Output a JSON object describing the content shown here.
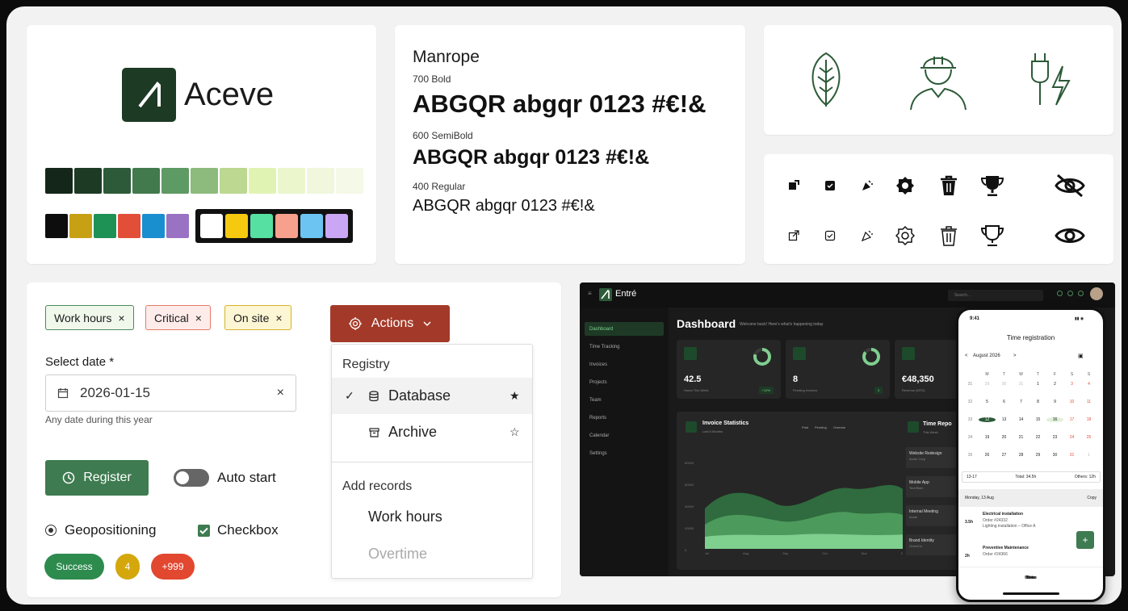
{
  "brand": {
    "name": "Aceve"
  },
  "palette": {
    "greens": [
      "#14261a",
      "#1d3a24",
      "#2d5a38",
      "#427a4e",
      "#5e9a63",
      "#8dba7d",
      "#bcd891",
      "#e1f3b2",
      "#ebf6cd",
      "#f0f7dc",
      "#f4f9e8"
    ],
    "accents": [
      "#0d0d0d",
      "#c8a013",
      "#1e9155",
      "#e24e38",
      "#1a8fd0",
      "#9a72c3"
    ],
    "accents_light": [
      "#ffffff",
      "#f5c90f",
      "#56e0a2",
      "#f7a08e",
      "#6cc4f2",
      "#cba6f5"
    ]
  },
  "typography": {
    "family": "Manrope",
    "styles": [
      {
        "weight_label": "700 Bold",
        "sample": "ABGQR abgqr 0123 #€!&"
      },
      {
        "weight_label": "600 SemiBold",
        "sample": "ABGQR abgqr 0123 #€!&"
      },
      {
        "weight_label": "400 Regular",
        "sample": "ABGQR abgqr 0123 #€!&"
      }
    ]
  },
  "form": {
    "chips": [
      {
        "label": "Work hours",
        "close": "×"
      },
      {
        "label": "Critical",
        "close": "×"
      },
      {
        "label": "On site",
        "close": "×"
      }
    ],
    "date_label": "Select date *",
    "date_value": "2026-01-15",
    "date_clear": "×",
    "date_hint": "Any date during this year",
    "register_label": "Register",
    "toggle_label": "Auto start",
    "radio_label": "Geopositioning",
    "checkbox_label": "Checkbox",
    "badges": [
      "Success",
      "4",
      "+999"
    ],
    "actions_label": "Actions",
    "menu": {
      "section1": "Registry",
      "item_database": "Database",
      "item_archive": "Archive",
      "section2": "Add records",
      "item_work_hours": "Work hours",
      "item_overtime": "Overtime"
    }
  },
  "dashboard": {
    "app_name": "Entré",
    "search_placeholder": "Search...",
    "title": "Dashboard",
    "welcome": "Welcome back! Here's what's happening today",
    "nav": [
      "Dashboard",
      "Time Tracking",
      "Invoices",
      "Projects",
      "Team",
      "Reports",
      "Calendar",
      "Settings"
    ],
    "kpis": [
      {
        "value": "42.5",
        "label": "Hours This Week",
        "tag": "+12%"
      },
      {
        "value": "8",
        "label": "Pending invoices",
        "tag": "3"
      },
      {
        "value": "€48,350",
        "label": "Revenue (MTD)",
        "tag": ""
      }
    ],
    "chart_title": "Invoice Statistics",
    "chart_sub": "Last 6 Months",
    "legend": [
      "Paid",
      "Pending",
      "Overdue"
    ],
    "y_ticks": [
      "80000",
      "60000",
      "40000",
      "20000",
      "0"
    ],
    "x_ticks": [
      "Jul",
      "Aug",
      "Sep",
      "Oct",
      "Nov",
      "Dec"
    ],
    "time_title": "Time Repo",
    "time_sub": "This Week",
    "projects": [
      {
        "name": "Website Redesign",
        "client": "Acme Corp"
      },
      {
        "name": "Mobile App",
        "client": "TechStart"
      },
      {
        "name": "Internal Meeting",
        "client": "Acme"
      },
      {
        "name": "Brand Identity",
        "client": "GreenCo"
      }
    ]
  },
  "phone": {
    "time": "9:41",
    "title": "Time registration",
    "month": "August 2026",
    "weekdays": [
      "M",
      "T",
      "W",
      "T",
      "F",
      "S",
      "S"
    ],
    "week_nums": [
      "31",
      "32",
      "33",
      "34",
      "35"
    ],
    "days": [
      [
        "29",
        "30",
        "31",
        "1",
        "2",
        "3",
        "4"
      ],
      [
        "5",
        "6",
        "7",
        "8",
        "9",
        "10",
        "11"
      ],
      [
        "12",
        "13",
        "14",
        "15",
        "16",
        "17",
        "18"
      ],
      [
        "19",
        "20",
        "21",
        "22",
        "23",
        "24",
        "25"
      ],
      [
        "26",
        "27",
        "28",
        "29",
        "30",
        "31",
        "1"
      ]
    ],
    "range": "13-17",
    "total": "Total: 34.5h",
    "others": "Others: 12h",
    "day_header": "Monday, 13 Aug",
    "copy": "Copy",
    "entries": [
      {
        "time": "3.5h",
        "title": "Electrical installation",
        "order": "Order #24332",
        "desc": "Lighting installation – Office A"
      },
      {
        "time": "2h",
        "title": "Preventive Maintenance",
        "order": "Order #24366",
        "desc": ""
      }
    ],
    "tabs": [
      "Home",
      "Orders",
      "Tasks",
      "Time",
      "More"
    ]
  }
}
